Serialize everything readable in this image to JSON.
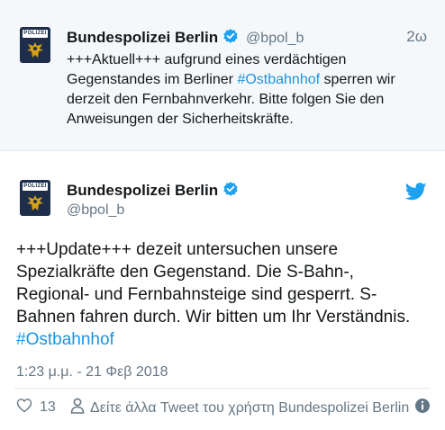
{
  "parent_tweet": {
    "name": "Bundespolizei Berlin",
    "handle": "@bpol_b",
    "time": "2ω",
    "text_before": "+++Aktuell+++ aufgrund eines verdächtigen Gegenstandes im Berliner ",
    "hashtag": "#Ostbahnhof",
    "text_after": " sperren wir derzeit den Fernbahnverkehr. Bitte folgen Sie den Anweisungen der Sicherheitskräfte."
  },
  "main_tweet": {
    "name": "Bundespolizei Berlin",
    "handle": "@bpol_b",
    "text_before": "+++Update+++ dezeit untersuchen unsere Spezialkräfte den Gegenstand. Die S-Bahn-, Regional- und Fernbahnsteige sind gesperrt. S-Bahnen fahren durch. Wir bitten um Ihr Verständnis. ",
    "hashtag": "#Ostbahnhof",
    "timestamp": "1:23 μ.μ. - 21 Φεβ 2018",
    "like_count": "13",
    "see_more_label": "Δείτε άλλα Tweet του χρήστη Bundespolizei Berlin"
  },
  "avatar": {
    "badge_text": "POLIZEI"
  },
  "icons": {
    "verified": "verified-badge-icon",
    "bird": "twitter-bird-icon",
    "heart": "heart-icon",
    "person": "person-icon",
    "info": "info-icon"
  },
  "colors": {
    "link": "#1b95e0",
    "verified": "#1da1f2",
    "muted": "#657786",
    "parent_bg": "#f5f8fa",
    "avatar_bg": "#1e2e4a"
  }
}
